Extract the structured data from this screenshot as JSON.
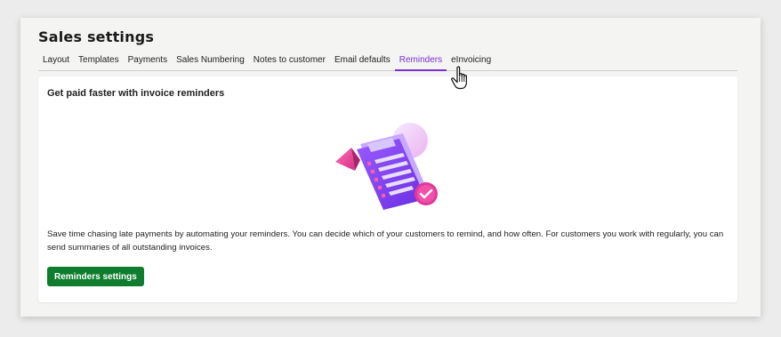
{
  "page": {
    "title": "Sales settings"
  },
  "tabs": [
    {
      "label": "Layout",
      "active": false
    },
    {
      "label": "Templates",
      "active": false
    },
    {
      "label": "Payments",
      "active": false
    },
    {
      "label": "Sales Numbering",
      "active": false
    },
    {
      "label": "Notes to customer",
      "active": false
    },
    {
      "label": "Email defaults",
      "active": false
    },
    {
      "label": "Reminders",
      "active": true
    },
    {
      "label": "eInvoicing",
      "active": false
    }
  ],
  "reminders": {
    "heading": "Get paid faster with invoice reminders",
    "illustration_icon": "invoice-reminder-illustration",
    "description": "Save time chasing late payments by automating your reminders. You can decide which of your customers to remind, and how often. For customers you work with regularly, you can send summaries of all outstanding invoices.",
    "button_label": "Reminders settings"
  },
  "colors": {
    "accent": "#7a2fd6",
    "primary_button": "#0f7d2e",
    "illustration_purple": "#7b3df0",
    "illustration_pink": "#e0399a"
  },
  "cursor_icon": "hand-pointer-icon"
}
